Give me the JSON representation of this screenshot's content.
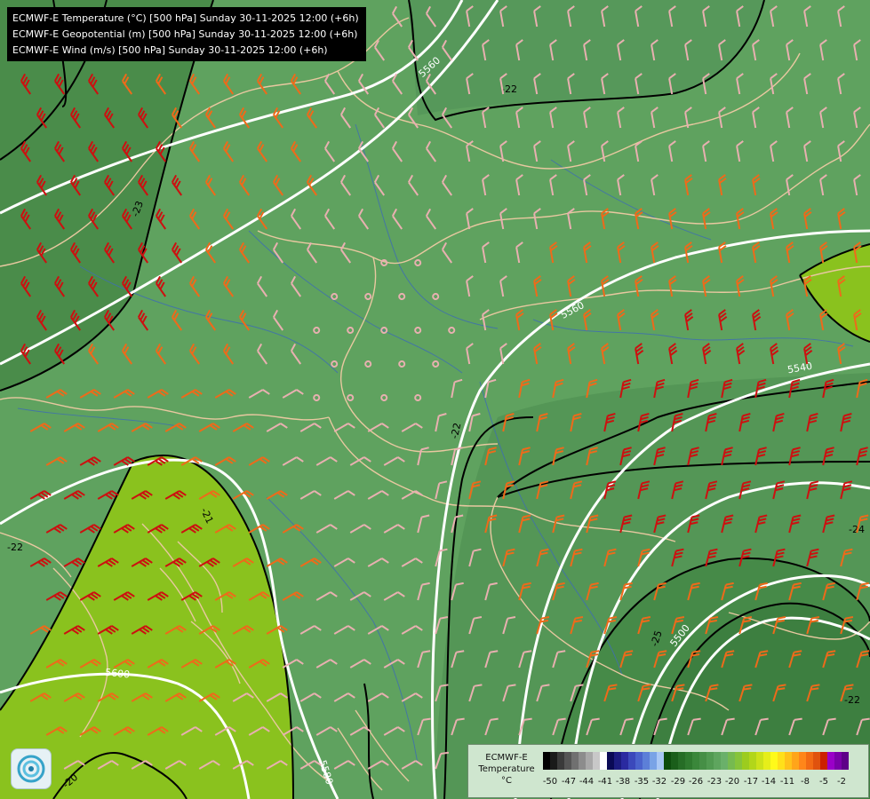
{
  "title_lines": [
    "ECMWF-E Temperature (°C) [500 hPa] Sunday 30-11-2025 12:00 (+6h)",
    "ECMWF-E Geopotential (m) [500 hPa] Sunday 30-11-2025 12:00 (+6h)",
    "ECMWF-E Wind (m/s) [500 hPa] Sunday 30-11-2025 12:00 (+6h)"
  ],
  "legend": {
    "title_lines": [
      "ECMWF-E",
      "Temperature",
      "°C"
    ],
    "ticks": [
      "-50",
      "-47",
      "-44",
      "-41",
      "-38",
      "-35",
      "-32",
      "-29",
      "-26",
      "-23",
      "-20",
      "-17",
      "-14",
      "-11",
      "-8",
      "-5",
      "-2"
    ],
    "colors": [
      "#000000",
      "#1a1a1a",
      "#3a3a3a",
      "#555555",
      "#707070",
      "#8c8c8c",
      "#a8a8a8",
      "#c8c8c8",
      "#ffffff",
      "#0a0a55",
      "#1c1c80",
      "#2a2aa0",
      "#3b49bb",
      "#4a63cc",
      "#5c7fd8",
      "#79a3e6",
      "#a9c8f5",
      "#0d4d0d",
      "#1a5e1a",
      "#266d26",
      "#2f7a2f",
      "#3a873a",
      "#468f46",
      "#519a51",
      "#5ea55e",
      "#6ab06a",
      "#76ba50",
      "#86c43a",
      "#9ccc1e",
      "#b2d61a",
      "#cce21a",
      "#e6ee1a",
      "#fffa1a",
      "#ffe01a",
      "#ffc21a",
      "#ffa51a",
      "#ff861a",
      "#f26a14",
      "#e0520e",
      "#cc2000",
      "#9a00c8",
      "#7a00a8",
      "#5e0088"
    ],
    "bar_colors_role": "temperature scale"
  },
  "contours": {
    "geopotential_labels": [
      "5560",
      "5560",
      "5540",
      "5500",
      "5600",
      "5580",
      "5520"
    ],
    "temperature_labels": [
      "-22",
      "-23",
      "-22",
      "-21",
      "-22",
      "-24",
      "-25",
      "-20",
      "-22"
    ]
  },
  "colors": {
    "background": "#5f9f5f",
    "warm_zone": "#8ac21e",
    "cold_zone": "#3f7f3f",
    "geopotential_line": "#ffffff",
    "temperature_line": "#000000",
    "border_line": "#e8c8a0",
    "river_line": "#3f6fb0",
    "wind_slow": "#e8b0b0",
    "wind_medium": "#ee6a1a",
    "wind_fast": "#cc1010"
  },
  "logo_icon": "ecmwf-logo-icon"
}
